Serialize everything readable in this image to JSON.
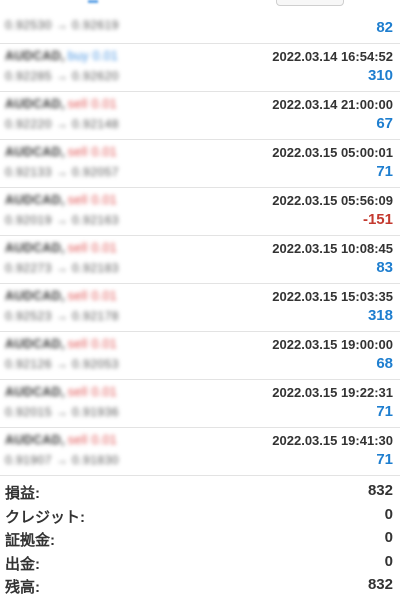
{
  "top_entry": {
    "price_line": "0.92530 → 0.92619",
    "profit": "82"
  },
  "trades": [
    {
      "symbol": "AUDCAD,",
      "side": "buy 0.01",
      "side_type": "buy",
      "time": "2022.03.14 16:54:52",
      "price_line": "0.92285 → 0.92620",
      "profit": "310",
      "profit_sign": "positive"
    },
    {
      "symbol": "AUDCAD,",
      "side": "sell 0.01",
      "side_type": "sell",
      "time": "2022.03.14 21:00:00",
      "price_line": "0.92220 → 0.92148",
      "profit": "67",
      "profit_sign": "positive"
    },
    {
      "symbol": "AUDCAD,",
      "side": "sell 0.01",
      "side_type": "sell",
      "time": "2022.03.15 05:00:01",
      "price_line": "0.92133 → 0.92057",
      "profit": "71",
      "profit_sign": "positive"
    },
    {
      "symbol": "AUDCAD,",
      "side": "sell 0.01",
      "side_type": "sell",
      "time": "2022.03.15 05:56:09",
      "price_line": "0.92019 → 0.92163",
      "profit": "-151",
      "profit_sign": "negative"
    },
    {
      "symbol": "AUDCAD,",
      "side": "sell 0.01",
      "side_type": "sell",
      "time": "2022.03.15 10:08:45",
      "price_line": "0.92273 → 0.92183",
      "profit": "83",
      "profit_sign": "positive"
    },
    {
      "symbol": "AUDCAD,",
      "side": "sell 0.01",
      "side_type": "sell",
      "time": "2022.03.15 15:03:35",
      "price_line": "0.92523 → 0.92178",
      "profit": "318",
      "profit_sign": "positive"
    },
    {
      "symbol": "AUDCAD,",
      "side": "sell 0.01",
      "side_type": "sell",
      "time": "2022.03.15 19:00:00",
      "price_line": "0.92126 → 0.92053",
      "profit": "68",
      "profit_sign": "positive"
    },
    {
      "symbol": "AUDCAD,",
      "side": "sell 0.01",
      "side_type": "sell",
      "time": "2022.03.15 19:22:31",
      "price_line": "0.92015 → 0.91936",
      "profit": "71",
      "profit_sign": "positive"
    },
    {
      "symbol": "AUDCAD,",
      "side": "sell 0.01",
      "side_type": "sell",
      "time": "2022.03.15 19:41:30",
      "price_line": "0.91907 → 0.91830",
      "profit": "71",
      "profit_sign": "positive"
    }
  ],
  "summary": [
    {
      "label": "損益:",
      "value": "832"
    },
    {
      "label": "クレジット:",
      "value": "0"
    },
    {
      "label": "証拠金:",
      "value": "0"
    },
    {
      "label": "出金:",
      "value": "0"
    },
    {
      "label": "残高:",
      "value": "832"
    }
  ],
  "colors": {
    "profit_positive": "#1e7ecf",
    "profit_negative": "#c43a2f",
    "buy": "#3f8fe0",
    "sell": "#e05050",
    "divider": "#e3e3e3"
  }
}
